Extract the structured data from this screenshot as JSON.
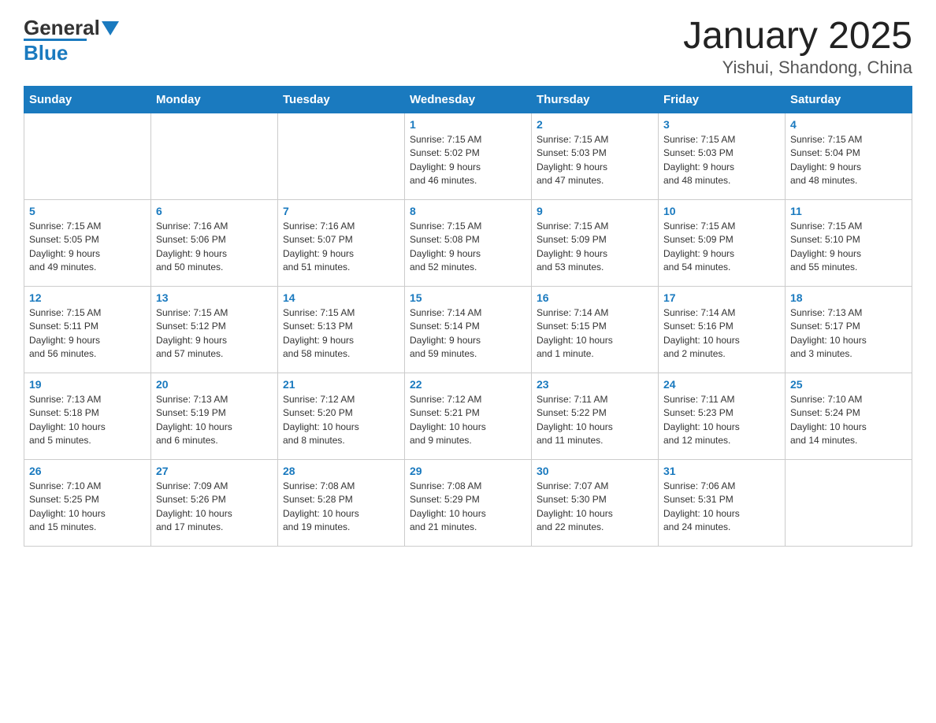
{
  "header": {
    "logo_line1": "General",
    "logo_line2": "Blue",
    "title": "January 2025",
    "subtitle": "Yishui, Shandong, China"
  },
  "days_of_week": [
    "Sunday",
    "Monday",
    "Tuesday",
    "Wednesday",
    "Thursday",
    "Friday",
    "Saturday"
  ],
  "weeks": [
    [
      {
        "day": "",
        "info": ""
      },
      {
        "day": "",
        "info": ""
      },
      {
        "day": "",
        "info": ""
      },
      {
        "day": "1",
        "info": "Sunrise: 7:15 AM\nSunset: 5:02 PM\nDaylight: 9 hours\nand 46 minutes."
      },
      {
        "day": "2",
        "info": "Sunrise: 7:15 AM\nSunset: 5:03 PM\nDaylight: 9 hours\nand 47 minutes."
      },
      {
        "day": "3",
        "info": "Sunrise: 7:15 AM\nSunset: 5:03 PM\nDaylight: 9 hours\nand 48 minutes."
      },
      {
        "day": "4",
        "info": "Sunrise: 7:15 AM\nSunset: 5:04 PM\nDaylight: 9 hours\nand 48 minutes."
      }
    ],
    [
      {
        "day": "5",
        "info": "Sunrise: 7:15 AM\nSunset: 5:05 PM\nDaylight: 9 hours\nand 49 minutes."
      },
      {
        "day": "6",
        "info": "Sunrise: 7:16 AM\nSunset: 5:06 PM\nDaylight: 9 hours\nand 50 minutes."
      },
      {
        "day": "7",
        "info": "Sunrise: 7:16 AM\nSunset: 5:07 PM\nDaylight: 9 hours\nand 51 minutes."
      },
      {
        "day": "8",
        "info": "Sunrise: 7:15 AM\nSunset: 5:08 PM\nDaylight: 9 hours\nand 52 minutes."
      },
      {
        "day": "9",
        "info": "Sunrise: 7:15 AM\nSunset: 5:09 PM\nDaylight: 9 hours\nand 53 minutes."
      },
      {
        "day": "10",
        "info": "Sunrise: 7:15 AM\nSunset: 5:09 PM\nDaylight: 9 hours\nand 54 minutes."
      },
      {
        "day": "11",
        "info": "Sunrise: 7:15 AM\nSunset: 5:10 PM\nDaylight: 9 hours\nand 55 minutes."
      }
    ],
    [
      {
        "day": "12",
        "info": "Sunrise: 7:15 AM\nSunset: 5:11 PM\nDaylight: 9 hours\nand 56 minutes."
      },
      {
        "day": "13",
        "info": "Sunrise: 7:15 AM\nSunset: 5:12 PM\nDaylight: 9 hours\nand 57 minutes."
      },
      {
        "day": "14",
        "info": "Sunrise: 7:15 AM\nSunset: 5:13 PM\nDaylight: 9 hours\nand 58 minutes."
      },
      {
        "day": "15",
        "info": "Sunrise: 7:14 AM\nSunset: 5:14 PM\nDaylight: 9 hours\nand 59 minutes."
      },
      {
        "day": "16",
        "info": "Sunrise: 7:14 AM\nSunset: 5:15 PM\nDaylight: 10 hours\nand 1 minute."
      },
      {
        "day": "17",
        "info": "Sunrise: 7:14 AM\nSunset: 5:16 PM\nDaylight: 10 hours\nand 2 minutes."
      },
      {
        "day": "18",
        "info": "Sunrise: 7:13 AM\nSunset: 5:17 PM\nDaylight: 10 hours\nand 3 minutes."
      }
    ],
    [
      {
        "day": "19",
        "info": "Sunrise: 7:13 AM\nSunset: 5:18 PM\nDaylight: 10 hours\nand 5 minutes."
      },
      {
        "day": "20",
        "info": "Sunrise: 7:13 AM\nSunset: 5:19 PM\nDaylight: 10 hours\nand 6 minutes."
      },
      {
        "day": "21",
        "info": "Sunrise: 7:12 AM\nSunset: 5:20 PM\nDaylight: 10 hours\nand 8 minutes."
      },
      {
        "day": "22",
        "info": "Sunrise: 7:12 AM\nSunset: 5:21 PM\nDaylight: 10 hours\nand 9 minutes."
      },
      {
        "day": "23",
        "info": "Sunrise: 7:11 AM\nSunset: 5:22 PM\nDaylight: 10 hours\nand 11 minutes."
      },
      {
        "day": "24",
        "info": "Sunrise: 7:11 AM\nSunset: 5:23 PM\nDaylight: 10 hours\nand 12 minutes."
      },
      {
        "day": "25",
        "info": "Sunrise: 7:10 AM\nSunset: 5:24 PM\nDaylight: 10 hours\nand 14 minutes."
      }
    ],
    [
      {
        "day": "26",
        "info": "Sunrise: 7:10 AM\nSunset: 5:25 PM\nDaylight: 10 hours\nand 15 minutes."
      },
      {
        "day": "27",
        "info": "Sunrise: 7:09 AM\nSunset: 5:26 PM\nDaylight: 10 hours\nand 17 minutes."
      },
      {
        "day": "28",
        "info": "Sunrise: 7:08 AM\nSunset: 5:28 PM\nDaylight: 10 hours\nand 19 minutes."
      },
      {
        "day": "29",
        "info": "Sunrise: 7:08 AM\nSunset: 5:29 PM\nDaylight: 10 hours\nand 21 minutes."
      },
      {
        "day": "30",
        "info": "Sunrise: 7:07 AM\nSunset: 5:30 PM\nDaylight: 10 hours\nand 22 minutes."
      },
      {
        "day": "31",
        "info": "Sunrise: 7:06 AM\nSunset: 5:31 PM\nDaylight: 10 hours\nand 24 minutes."
      },
      {
        "day": "",
        "info": ""
      }
    ]
  ]
}
